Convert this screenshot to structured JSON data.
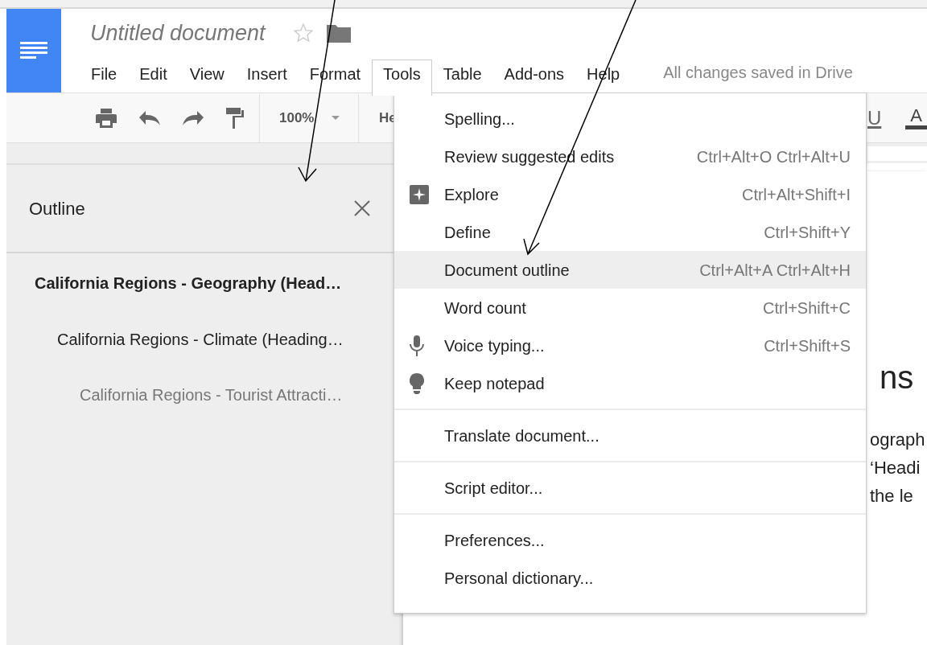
{
  "document": {
    "title": "Untitled document",
    "starred": false
  },
  "menu_bar": [
    {
      "label": "File",
      "selected": false
    },
    {
      "label": "Edit",
      "selected": false
    },
    {
      "label": "View",
      "selected": false
    },
    {
      "label": "Insert",
      "selected": false
    },
    {
      "label": "Format",
      "selected": false
    },
    {
      "label": "Tools",
      "selected": true
    },
    {
      "label": "Table",
      "selected": false
    },
    {
      "label": "Add-ons",
      "selected": false
    },
    {
      "label": "Help",
      "selected": false
    }
  ],
  "save_status": "All changes saved in Drive",
  "toolbar": {
    "zoom": "100%",
    "style": "He",
    "underline": "U",
    "text_color": "A"
  },
  "outline": {
    "title": "Outline",
    "headings": [
      {
        "text": "California Regions - Geography (Head…",
        "children": [
          {
            "text": "California Regions - Climate (Heading…",
            "children": [
              {
                "text": "California Regions - Tourist Attracti…"
              }
            ]
          }
        ]
      }
    ]
  },
  "tools_menu": [
    [
      {
        "label": "Spelling...",
        "kind": "plain",
        "selected": false
      },
      {
        "label": "Review suggested edits",
        "shortcut": "Ctrl+Alt+O Ctrl+Alt+U",
        "kind": "plain",
        "selected": false
      },
      {
        "label": "Explore",
        "shortcut": "Ctrl+Alt+Shift+I",
        "kind": "explore",
        "selected": false
      },
      {
        "label": "Define",
        "shortcut": "Ctrl+Shift+Y",
        "kind": "plain",
        "selected": false
      },
      {
        "label": "Document outline",
        "shortcut": "Ctrl+Alt+A Ctrl+Alt+H",
        "kind": "plain",
        "selected": true
      },
      {
        "label": "Word count",
        "shortcut": "Ctrl+Shift+C",
        "kind": "plain",
        "selected": false
      },
      {
        "label": "Voice typing...",
        "shortcut": "Ctrl+Shift+S",
        "kind": "microphone",
        "selected": false
      },
      {
        "label": "Keep notepad",
        "kind": "lightbulb",
        "selected": false
      }
    ],
    [
      {
        "label": "Translate document...",
        "kind": "plain",
        "selected": false
      }
    ],
    [
      {
        "label": "Script editor...",
        "kind": "plain",
        "selected": false
      }
    ],
    [
      {
        "label": "Preferences...",
        "kind": "plain",
        "selected": false
      },
      {
        "label": "Personal dictionary...",
        "kind": "plain",
        "selected": false
      }
    ]
  ],
  "page": {
    "heading": "ns",
    "lines": [
      "ograph",
      "‘Headi",
      "the le"
    ]
  }
}
